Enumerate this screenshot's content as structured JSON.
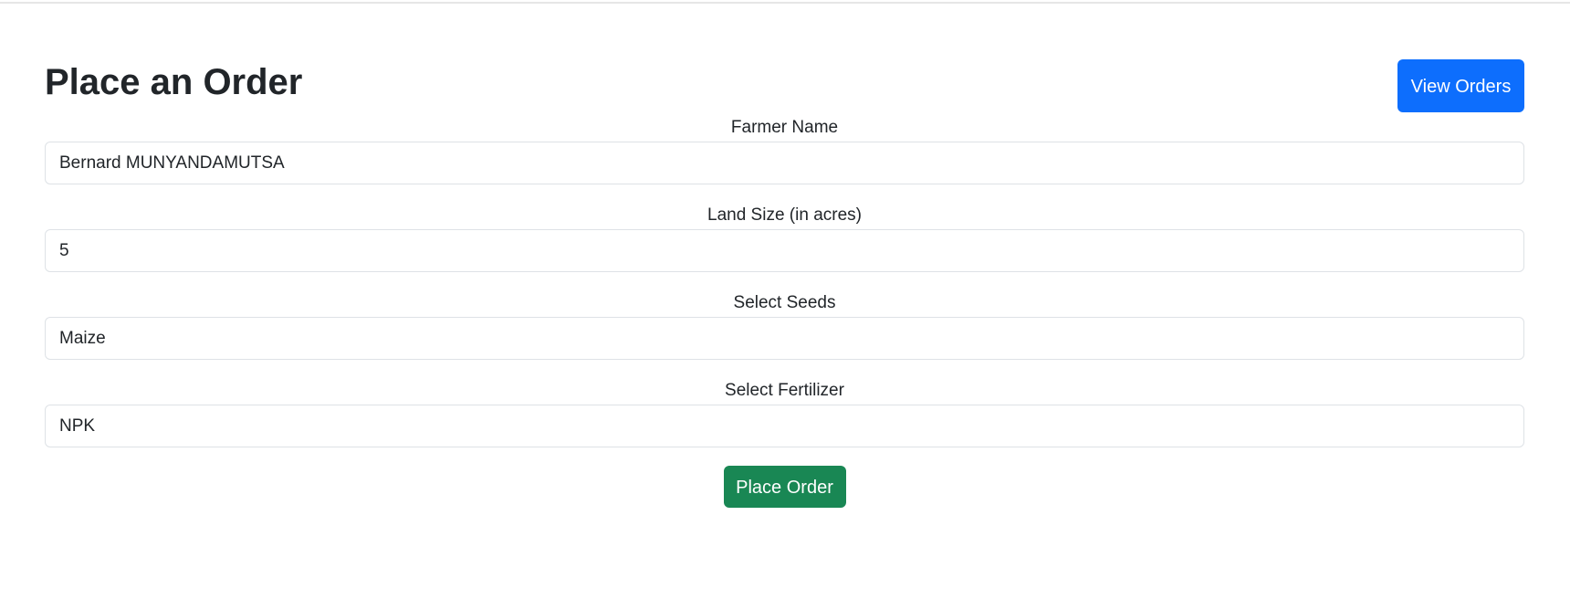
{
  "page": {
    "title": "Place an Order",
    "view_orders_label": "View Orders"
  },
  "form": {
    "fields": [
      {
        "label": "Farmer Name",
        "value": "Bernard MUNYANDAMUTSA"
      },
      {
        "label": "Land Size (in acres)",
        "value": "5"
      },
      {
        "label": "Select Seeds",
        "value": "Maize"
      },
      {
        "label": "Select Fertilizer",
        "value": "NPK"
      }
    ],
    "submit_label": "Place Order"
  },
  "colors": {
    "primary": "#0d6efd",
    "success": "#198754",
    "border": "#dee2e6",
    "text": "#212529"
  }
}
